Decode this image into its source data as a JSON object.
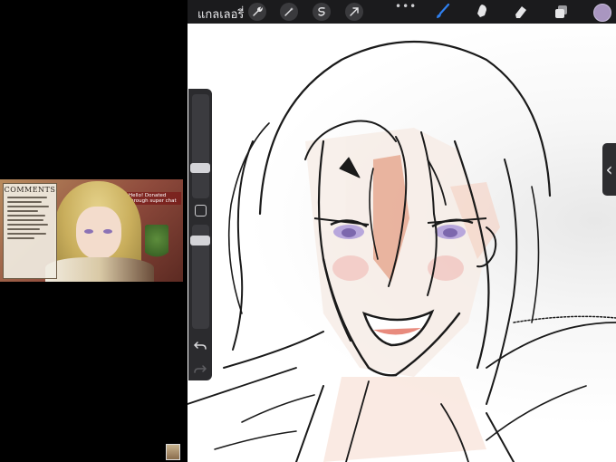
{
  "toolbar": {
    "gallery_label": "แกลเลอรี่",
    "actions": [
      {
        "name": "wrench-icon"
      },
      {
        "name": "magic-wand-icon"
      },
      {
        "name": "selection-icon"
      },
      {
        "name": "transform-arrow-icon"
      }
    ],
    "more_label": "•••",
    "tools": [
      {
        "name": "brush-icon",
        "active": true
      },
      {
        "name": "smudge-icon",
        "active": false
      },
      {
        "name": "eraser-icon",
        "active": false
      },
      {
        "name": "layers-icon",
        "active": false
      }
    ],
    "current_color": "#a996c0",
    "accent_color": "#2f80f0"
  },
  "sidebar": {
    "brush_size_icon": "brush-size-slider",
    "modify_icon": "square-icon",
    "opacity_icon": "opacity-slider",
    "undo_icon": "undo-icon",
    "redo_icon": "redo-icon"
  },
  "right_handle": {
    "icon": "chevron-left-icon",
    "glyph": "‹"
  },
  "stream_preview": {
    "comments_title": "COMMENTS",
    "superchat_text": "Hello! Donated through super chat"
  }
}
